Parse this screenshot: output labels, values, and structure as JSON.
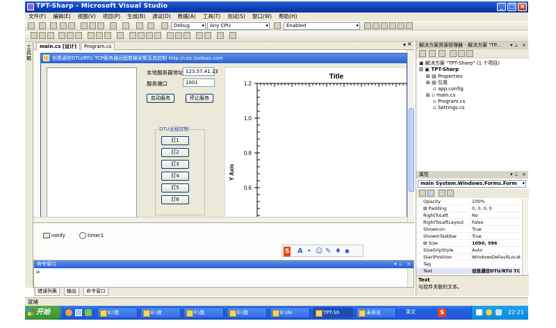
{
  "app": {
    "title": "TPT-Sharp - Microsoft Visual Studio",
    "menu": [
      "文件(F)",
      "编辑(E)",
      "视图(V)",
      "项目(P)",
      "生成(B)",
      "调试(D)",
      "数据(A)",
      "工具(T)",
      "测试(S)",
      "窗口(W)",
      "帮助(H)"
    ],
    "toolbar": {
      "config": "Debug",
      "platform": "Any CPU",
      "enabled": "Enabled"
    },
    "toolbox_label": "工具箱"
  },
  "doc_tabs": [
    "main.cs [设计]",
    "Program.cs"
  ],
  "form": {
    "title": "创恩通信DTU/RTU TCP服务器远程数据采集及其控制   http://csic.taobao.com",
    "server_addr_label": "本地服务器地址",
    "server_addr_value": "123.57.41.13",
    "port_label": "服务端口",
    "port_value": "1001",
    "start_button": "启动服务",
    "stop_button": "停止服务",
    "group_title": "DTU远程控制",
    "lamps": [
      "灯1",
      "灯2",
      "灯3",
      "灯4",
      "灯5",
      "灯6"
    ]
  },
  "chart_data": {
    "type": "line",
    "title": "Title",
    "ylabel": "Y Axis",
    "xlabel": "",
    "yticks": [
      "1.2",
      "1.0",
      "0.8",
      "0.6"
    ],
    "ylim": [
      0.6,
      1.2
    ],
    "series": []
  },
  "tray_components": [
    "notify",
    "timer1"
  ],
  "ime_bar": [
    "S",
    "A",
    "•",
    "☺",
    "✎",
    "♦",
    "▪"
  ],
  "command_window": {
    "title": "命令窗口",
    "prompt": ">"
  },
  "bottom_tabs": [
    "错误列表",
    "输出",
    "命令窗口"
  ],
  "solution_explorer": {
    "title": "解决方案资源管理器 - 解决方案 \"TP...",
    "items": [
      "解决方案 \"TPT-Sharp\" (1 个项目)",
      "TPT-Sharp",
      "Properties",
      "引用",
      "app.config",
      "main.cs",
      "Program.cs",
      "Settings.cs"
    ]
  },
  "properties": {
    "title": "属性",
    "object": "main System.Windows.Forms.Form",
    "rows": [
      [
        "Opacity",
        "100%"
      ],
      [
        "⊞ Padding",
        "0, 0, 0, 0"
      ],
      [
        "RightToLeft",
        "No"
      ],
      [
        "RightToLeftLayout",
        "False"
      ],
      [
        "ShowIcon",
        "True"
      ],
      [
        "ShowInTaskbar",
        "True"
      ],
      [
        "⊞ Size",
        "1090, 586"
      ],
      [
        "SizeGripStyle",
        "Auto"
      ],
      [
        "StartPosition",
        "WindowsDefaultLocati"
      ],
      [
        "Tag",
        ""
      ],
      [
        "Text",
        "创恩通信DTU/RTU TC"
      ]
    ],
    "desc_title": "Text",
    "desc_text": "与控件关联的文本。"
  },
  "status": "就绪",
  "taskbar": {
    "start": "开始",
    "buttons": [
      "E:\\我",
      "E:\\官",
      "F:\\我",
      "E:\\我",
      "E:\\de",
      "TPT-Sh",
      "未命名"
    ],
    "ime": "英文",
    "clock": "22:21"
  }
}
